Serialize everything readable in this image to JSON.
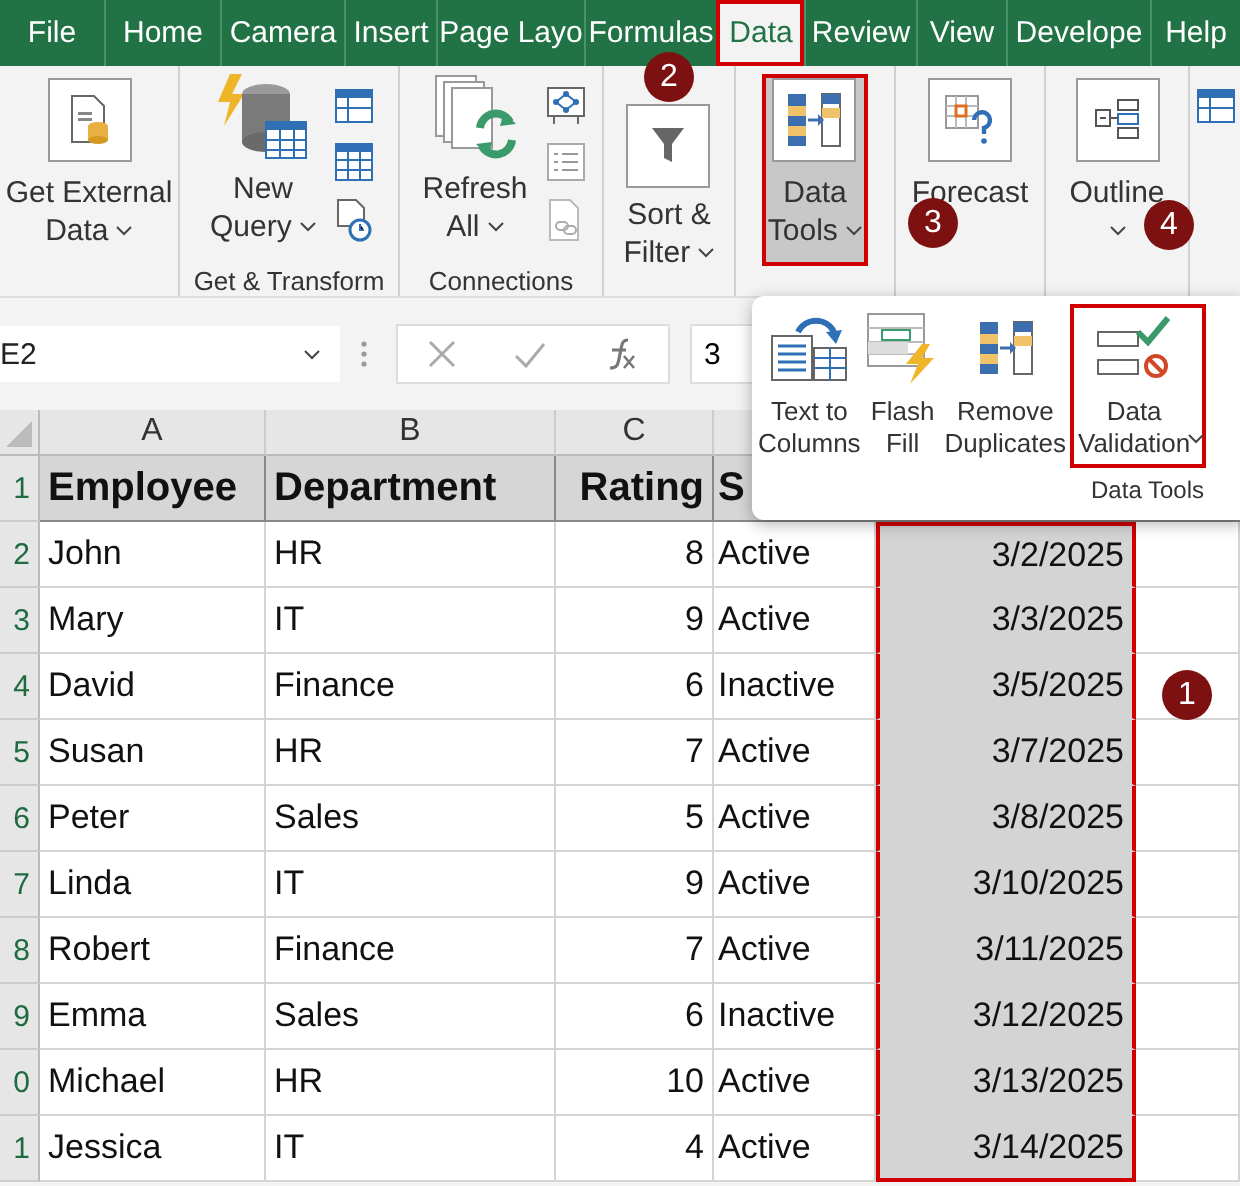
{
  "tabs": [
    {
      "label": "File",
      "selected": false
    },
    {
      "label": "Home",
      "selected": false
    },
    {
      "label": "Camera",
      "selected": false
    },
    {
      "label": "Insert",
      "selected": false
    },
    {
      "label": "Page Layo",
      "selected": false
    },
    {
      "label": "Formulas",
      "selected": false
    },
    {
      "label": "Data",
      "selected": true
    },
    {
      "label": "Review",
      "selected": false
    },
    {
      "label": "View",
      "selected": false
    },
    {
      "label": "Develope",
      "selected": false
    },
    {
      "label": "Help",
      "selected": false
    }
  ],
  "ribbon": {
    "groups": [
      {
        "buttons": [
          {
            "kind": "external-data",
            "lines": [
              "Get External",
              "Data"
            ],
            "dropdown": true,
            "selected": false,
            "highlighted": false
          }
        ]
      },
      {
        "label": "Get & Transform",
        "buttons": [
          {
            "kind": "query",
            "lines": [
              "New",
              "Query"
            ],
            "dropdown": true,
            "selected": false,
            "highlighted": false
          }
        ],
        "small_buttons": [
          {
            "kind": "table"
          },
          {
            "kind": "grid"
          },
          {
            "kind": "recent"
          }
        ]
      },
      {
        "label": "Connections",
        "buttons": [
          {
            "kind": "refresh",
            "lines": [
              "Refresh",
              "All"
            ],
            "dropdown": true,
            "selected": false,
            "highlighted": false
          }
        ],
        "small_buttons": [
          {
            "kind": "properties"
          },
          {
            "kind": "list"
          },
          {
            "kind": "link"
          }
        ]
      },
      {
        "buttons": [
          {
            "kind": "filter",
            "lines": [
              "Sort &",
              "Filter"
            ],
            "dropdown": true,
            "selected": false,
            "highlighted": false
          }
        ]
      },
      {
        "buttons": [
          {
            "kind": "data-tools",
            "lines": [
              "Data",
              "Tools"
            ],
            "dropdown": true,
            "selected": true,
            "highlighted": true
          }
        ]
      },
      {
        "buttons": [
          {
            "kind": "forecast",
            "lines": [
              "Forecast"
            ],
            "dropdown": false,
            "selected": false,
            "highlighted": false
          }
        ]
      },
      {
        "buttons": [
          {
            "kind": "outline",
            "lines": [
              "Outline"
            ],
            "dropdown": true,
            "selected": false,
            "highlighted": false
          }
        ]
      },
      {
        "small_buttons": [
          {
            "kind": "table"
          }
        ]
      }
    ]
  },
  "dropdown_panel": {
    "group_label": "Data Tools",
    "buttons": [
      {
        "kind": "text-to-columns",
        "lines": [
          "Text to",
          "Columns"
        ],
        "dropdown": false,
        "highlighted": false
      },
      {
        "kind": "flash-fill",
        "lines": [
          "Flash",
          "Fill"
        ],
        "dropdown": false,
        "highlighted": false
      },
      {
        "kind": "remove-duplicates",
        "lines": [
          "Remove",
          "Duplicates"
        ],
        "dropdown": false,
        "highlighted": false
      },
      {
        "kind": "data-validation",
        "lines": [
          "Data",
          "Validation"
        ],
        "dropdown": true,
        "highlighted": true
      }
    ]
  },
  "formula_bar": {
    "name_box": "E2",
    "formula": "3"
  },
  "sheet": {
    "columns": [
      {
        "label": "A",
        "kind": "text",
        "selected": false
      },
      {
        "label": "B",
        "kind": "text",
        "selected": false
      },
      {
        "label": "C",
        "kind": "number",
        "selected": false
      },
      {
        "kind": "text",
        "selected": false
      },
      {
        "kind": "number",
        "selected": true
      }
    ],
    "rows": [
      {
        "num": "1",
        "header": true,
        "cells": [
          "Employee",
          "Department",
          "Rating",
          "S"
        ]
      },
      {
        "num": "2",
        "header": false,
        "cells": [
          "John",
          "HR",
          "8",
          "Active",
          "3/2/2025"
        ]
      },
      {
        "num": "3",
        "header": false,
        "cells": [
          "Mary",
          "IT",
          "9",
          "Active",
          "3/3/2025"
        ]
      },
      {
        "num": "4",
        "header": false,
        "cells": [
          "David",
          "Finance",
          "6",
          "Inactive",
          "3/5/2025"
        ]
      },
      {
        "num": "5",
        "header": false,
        "cells": [
          "Susan",
          "HR",
          "7",
          "Active",
          "3/7/2025"
        ]
      },
      {
        "num": "6",
        "header": false,
        "cells": [
          "Peter",
          "Sales",
          "5",
          "Active",
          "3/8/2025"
        ]
      },
      {
        "num": "7",
        "header": false,
        "cells": [
          "Linda",
          "IT",
          "9",
          "Active",
          "3/10/2025"
        ]
      },
      {
        "num": "8",
        "header": false,
        "cells": [
          "Robert",
          "Finance",
          "7",
          "Active",
          "3/11/2025"
        ]
      },
      {
        "num": "9",
        "header": false,
        "cells": [
          "Emma",
          "Sales",
          "6",
          "Inactive",
          "3/12/2025"
        ]
      },
      {
        "num": "0",
        "header": false,
        "cells": [
          "Michael",
          "HR",
          "10",
          "Active",
          "3/13/2025"
        ]
      },
      {
        "num": "1",
        "header": false,
        "cells": [
          "Jessica",
          "IT",
          "4",
          "Active",
          "3/14/2025"
        ]
      }
    ]
  },
  "annotations": [
    {
      "label": "2"
    },
    {
      "label": "3"
    },
    {
      "label": "4"
    },
    {
      "label": "1"
    }
  ]
}
